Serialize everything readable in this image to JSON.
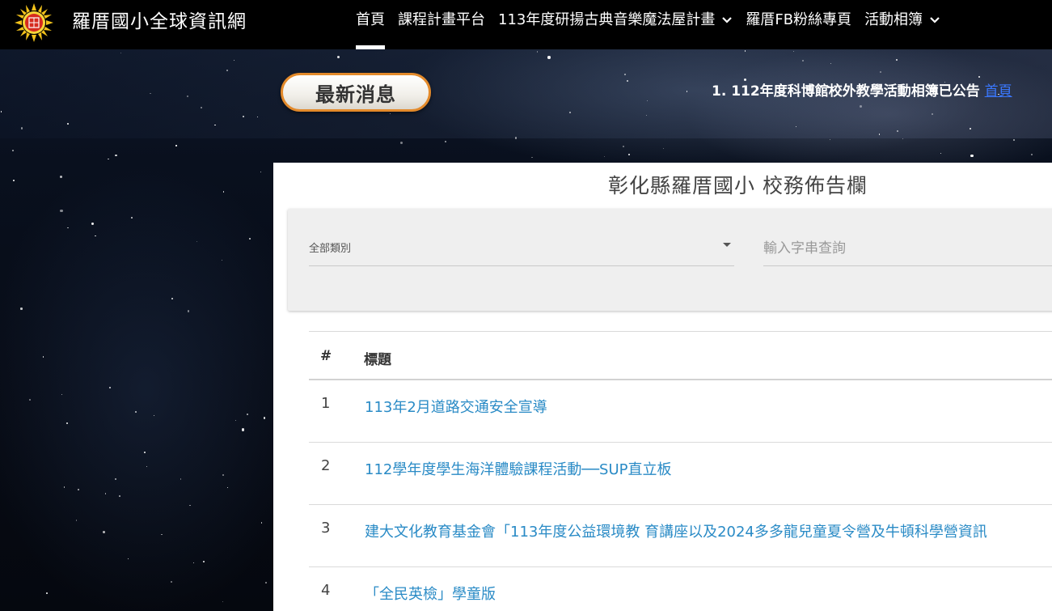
{
  "header": {
    "site_title": "羅厝國小全球資訊網",
    "logo_icon": "school-sun-logo",
    "nav": [
      {
        "label": "首頁",
        "active": true,
        "has_dropdown": false
      },
      {
        "label": "課程計畫平台",
        "active": false,
        "has_dropdown": false
      },
      {
        "label": "113年度研揚古典音樂魔法屋計畫",
        "active": false,
        "has_dropdown": true
      },
      {
        "label": "羅厝FB粉絲專頁",
        "active": false,
        "has_dropdown": false
      },
      {
        "label": "活動相簿",
        "active": false,
        "has_dropdown": true
      }
    ]
  },
  "news": {
    "pill_label": "最新消息",
    "ticker_text": "1. 112年度科博館校外教學活動相簿已公告",
    "ticker_link": "首頁"
  },
  "bulletin": {
    "title": "彰化縣羅厝國小 校務佈告欄",
    "category_label": "全部類別",
    "search_placeholder": "輸入字串查詢",
    "columns": {
      "num": "#",
      "title": "標題"
    },
    "rows": [
      {
        "num": "1",
        "title": "113年2月道路交通安全宣導"
      },
      {
        "num": "2",
        "title": "112學年度學生海洋體驗課程活動──SUP直立板"
      },
      {
        "num": "3",
        "title": "建大文化教育基金會「113年度公益環境教 育講座以及2024多多龍兒童夏令營及牛頓科學營資訊"
      },
      {
        "num": "4",
        "title": "「全民英檢」學童版"
      }
    ]
  },
  "colors": {
    "nav_bg": "#000000",
    "accent_orange": "#e38a2b",
    "link_blue": "#2a8bc6",
    "ticker_link": "#3a78ff"
  }
}
